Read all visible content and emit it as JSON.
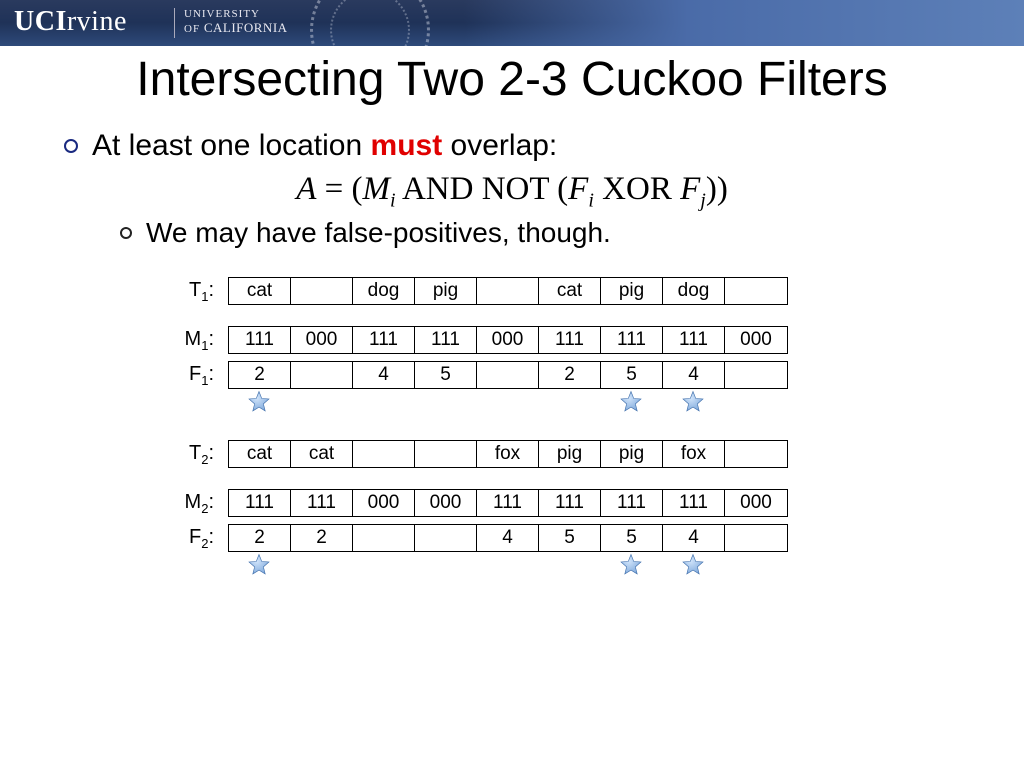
{
  "header": {
    "brand_bold": "UCI",
    "brand_rest": "rvine",
    "sub_line1": "UNIVERSITY",
    "sub_line2_of": "OF ",
    "sub_line2_cal": "CALIFORNIA"
  },
  "title": "Intersecting Two 2-3 Cuckoo Filters",
  "bullet1_pre": "At least one location ",
  "bullet1_must": "must",
  "bullet1_post": " overlap:",
  "formula": {
    "A": "A",
    "eq": " = (",
    "M": "M",
    "i1": "i",
    "and": " AND NOT (",
    "F1": "F",
    "i2": "i",
    "xor": " XOR ",
    "F2": "F",
    "j": "j",
    "close": "))"
  },
  "bullet2": "We may have false-positives, though.",
  "rows": {
    "T1": {
      "label": "T",
      "sub": "1",
      "cells": [
        "cat",
        "",
        "dog",
        "pig",
        "",
        "cat",
        "pig",
        "dog",
        ""
      ]
    },
    "M1": {
      "label": "M",
      "sub": "1",
      "cells": [
        "111",
        "000",
        "111",
        "111",
        "000",
        "111",
        "111",
        "111",
        "000"
      ]
    },
    "F1": {
      "label": "F",
      "sub": "1",
      "cells": [
        "2",
        "",
        "4",
        "5",
        "",
        "2",
        "5",
        "4",
        ""
      ]
    },
    "T2": {
      "label": "T",
      "sub": "2",
      "cells": [
        "cat",
        "cat",
        "",
        "",
        "fox",
        "pig",
        "pig",
        "fox",
        ""
      ]
    },
    "M2": {
      "label": "M",
      "sub": "2",
      "cells": [
        "111",
        "111",
        "000",
        "000",
        "111",
        "111",
        "111",
        "111",
        "000"
      ]
    },
    "F2": {
      "label": "F",
      "sub": "2",
      "cells": [
        "2",
        "2",
        "",
        "",
        "4",
        "5",
        "5",
        "4",
        ""
      ]
    }
  },
  "stars1": [
    true,
    false,
    false,
    false,
    false,
    false,
    true,
    true,
    false
  ],
  "stars2": [
    true,
    false,
    false,
    false,
    false,
    false,
    true,
    true,
    false
  ]
}
